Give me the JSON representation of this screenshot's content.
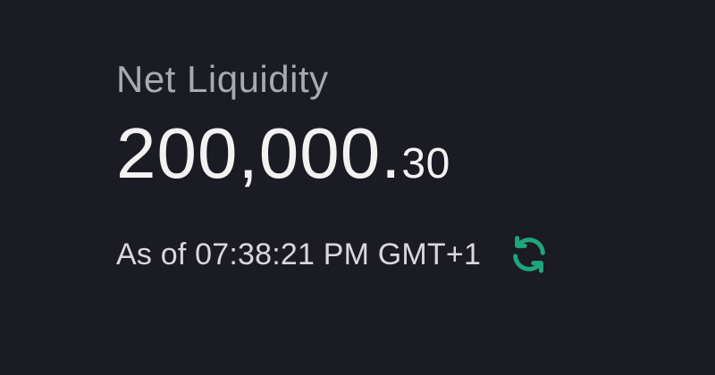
{
  "net_liquidity": {
    "label": "Net Liquidity",
    "value_integer": "200,000.",
    "value_decimal": "30",
    "as_of": "As of 07:38:21 PM GMT+1",
    "refresh_icon": "refresh-icon",
    "accent_color": "#1fa67a"
  }
}
